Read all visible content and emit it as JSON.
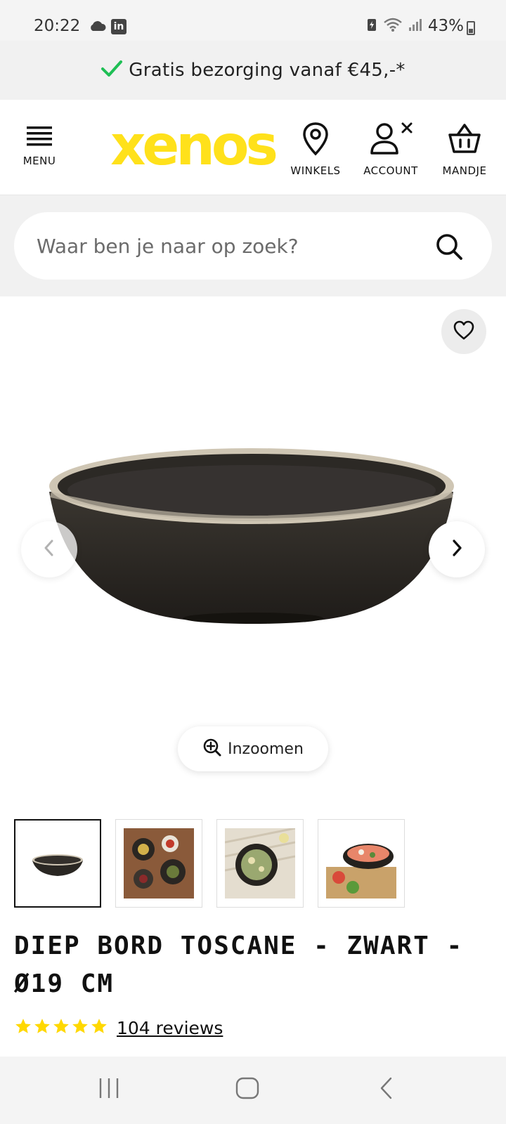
{
  "status_bar": {
    "time": "20:22",
    "battery": "43%",
    "icons": [
      "cloud-icon",
      "linkedin-icon",
      "battery-saver-icon",
      "wifi-icon",
      "signal-icon",
      "battery-icon"
    ],
    "linkedin_glyph": "in"
  },
  "promo": {
    "text": "Gratis bezorging vanaf €45,-*",
    "accent_color": "#1fbf55"
  },
  "header": {
    "logo_text": "xenos",
    "logo_color": "#ffe11b",
    "menu_label": "MENU",
    "nav": {
      "winkels": "WINKELS",
      "account": "ACCOUNT",
      "mandje": "MANDJE"
    }
  },
  "search": {
    "placeholder": "Waar ben je naar op zoek?",
    "value": ""
  },
  "gallery": {
    "zoom_label": "Inzoomen",
    "thumbnails": 4,
    "active_thumbnail": 1
  },
  "product": {
    "title": "DIEP BORD TOSCANE - ZWART - Ø19 CM",
    "rating_stars": 5,
    "reviews_label": "104 reviews",
    "star_color": "#ffd800"
  }
}
